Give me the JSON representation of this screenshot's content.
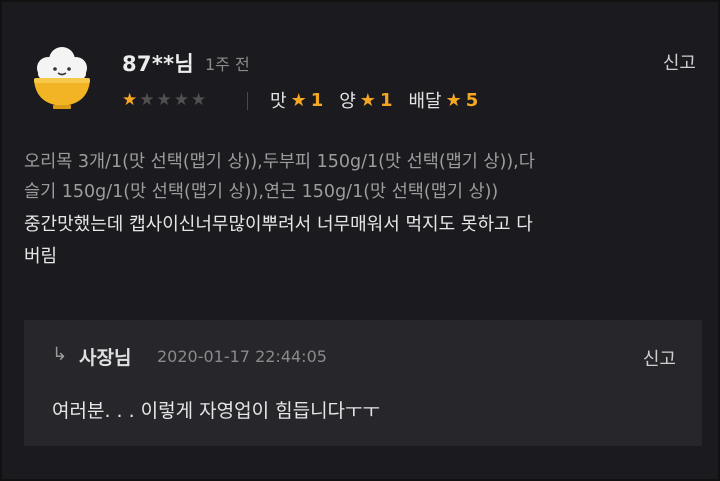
{
  "review": {
    "username": "87**님",
    "time_ago": "1주 전",
    "report_label": "신고",
    "rating_stars": 1,
    "rating_max": 5,
    "ratings": [
      {
        "label": "맛",
        "star": "★",
        "value": "1"
      },
      {
        "label": "양",
        "star": "★",
        "value": "1"
      },
      {
        "label": "배달",
        "star": "★",
        "value": "5"
      }
    ],
    "menu_line1": "오리목 3개/1(맛 선택(맵기 상)),두부피 150g/1(맛 선택(맵기 상)),다",
    "menu_line2": "슬기 150g/1(맛 선택(맵기 상)),연근 150g/1(맛 선택(맵기 상))",
    "text_line1": "중간맛했는데 캡사이신너무많이뿌려서 너무매워서 먹지도 못하고 다",
    "text_line2": "버림"
  },
  "reply": {
    "arrow": "↳",
    "author": "사장님",
    "date": "2020-01-17 22:44:05",
    "report_label": "신고",
    "text": "여러분. . . 이렇게 자영업이 힘듭니다ㅜㅜ"
  },
  "colors": {
    "background": "#1b1b1f",
    "reply_background": "#26262b",
    "star_accent": "#f5a623"
  }
}
